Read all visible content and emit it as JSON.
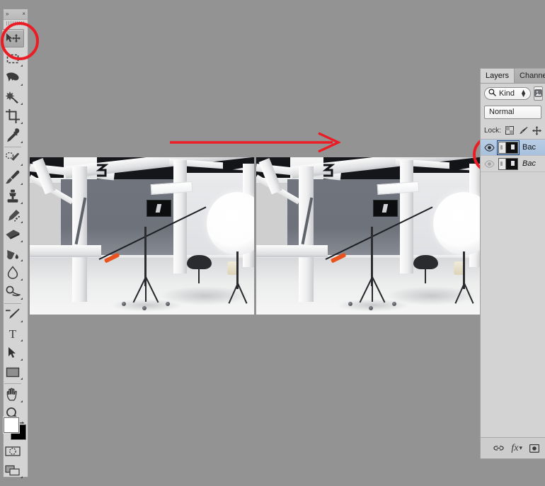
{
  "app": {
    "background_color": "#939393",
    "panel_color": "#d3d3d3",
    "annotation_color": "#ec1c24",
    "selection_color": "#a9c1de"
  },
  "toolbar": {
    "collapse_label": "»",
    "close_label": "×",
    "tools": [
      {
        "name": "move-tool",
        "title": "Move Tool",
        "active": true,
        "has_flyout": false
      },
      {
        "name": "rectangular-marquee-tool",
        "title": "Rectangular Marquee Tool",
        "active": false,
        "has_flyout": true
      },
      {
        "name": "lasso-tool",
        "title": "Lasso Tool",
        "active": false,
        "has_flyout": true
      },
      {
        "name": "quick-selection-tool",
        "title": "Quick Selection Tool",
        "active": false,
        "has_flyout": true
      },
      {
        "name": "crop-tool",
        "title": "Crop Tool",
        "active": false,
        "has_flyout": true
      },
      {
        "name": "eyedropper-tool",
        "title": "Eyedropper Tool",
        "active": false,
        "has_flyout": true
      },
      {
        "name": "spot-healing-brush-tool",
        "title": "Spot Healing Brush Tool",
        "active": false,
        "has_flyout": true
      },
      {
        "name": "brush-tool",
        "title": "Brush Tool",
        "active": false,
        "has_flyout": true
      },
      {
        "name": "clone-stamp-tool",
        "title": "Clone Stamp Tool",
        "active": false,
        "has_flyout": true
      },
      {
        "name": "history-brush-tool",
        "title": "History Brush Tool",
        "active": false,
        "has_flyout": true
      },
      {
        "name": "eraser-tool",
        "title": "Eraser Tool",
        "active": false,
        "has_flyout": true
      },
      {
        "name": "gradient-tool",
        "title": "Paint Bucket Tool",
        "active": false,
        "has_flyout": true
      },
      {
        "name": "blur-tool",
        "title": "Blur Tool",
        "active": false,
        "has_flyout": true
      },
      {
        "name": "dodge-tool",
        "title": "Dodge Tool",
        "active": false,
        "has_flyout": true
      },
      {
        "name": "pen-tool",
        "title": "Pen Tool",
        "active": false,
        "has_flyout": true
      },
      {
        "name": "type-tool",
        "title": "Horizontal Type Tool",
        "active": false,
        "has_flyout": true
      },
      {
        "name": "path-selection-tool",
        "title": "Path Selection Tool",
        "active": false,
        "has_flyout": true
      },
      {
        "name": "rectangle-shape-tool",
        "title": "Rectangle Tool",
        "active": false,
        "has_flyout": true
      },
      {
        "name": "hand-tool",
        "title": "Hand Tool",
        "active": false,
        "has_flyout": true
      },
      {
        "name": "zoom-tool",
        "title": "Zoom Tool",
        "active": false,
        "has_flyout": false
      }
    ],
    "foreground_color": "#ffffff",
    "background_color_swatch": "#000000",
    "quick_mask_title": "Edit in Quick Mask Mode",
    "screen_mode_title": "Change Screen Mode"
  },
  "canvas": {
    "documents": [
      {
        "name": "photo-before",
        "alt": "Photography studio interior with white wooden beams, boom light stand and octabox softbox"
      },
      {
        "name": "photo-after",
        "alt": "Same studio interior after edit, retouched version"
      }
    ]
  },
  "annotations": {
    "arrow": {
      "name": "red-arrow-annotation",
      "direction": "right"
    },
    "ellipses": [
      {
        "name": "move-tool-highlight"
      },
      {
        "name": "layer-visibility-highlight"
      }
    ]
  },
  "panel": {
    "tabs": [
      {
        "label": "Layers",
        "active": true
      },
      {
        "label": "Channels",
        "active": false
      }
    ],
    "filter": {
      "kind_label": "Kind",
      "search_icon": "search-icon",
      "pixel_filter_icon": "pixel-layer-filter-icon"
    },
    "blend_mode": "Normal",
    "lock": {
      "label": "Lock:",
      "buttons": [
        {
          "name": "lock-transparent-pixels-icon",
          "title": "Lock transparent pixels"
        },
        {
          "name": "lock-image-pixels-icon",
          "title": "Lock image pixels"
        },
        {
          "name": "lock-position-icon",
          "title": "Lock position"
        }
      ]
    },
    "layers": [
      {
        "name": "Bac",
        "visible": true,
        "selected": true,
        "italic": false,
        "thumb_selected": true
      },
      {
        "name": "Bac",
        "visible": false,
        "selected": false,
        "italic": true,
        "thumb_selected": false
      }
    ],
    "footer": [
      {
        "name": "link-layers-icon",
        "label": "⚭"
      },
      {
        "name": "layer-style-fx-icon",
        "label": "fx"
      },
      {
        "name": "add-layer-mask-icon",
        "label": "▣"
      }
    ]
  }
}
